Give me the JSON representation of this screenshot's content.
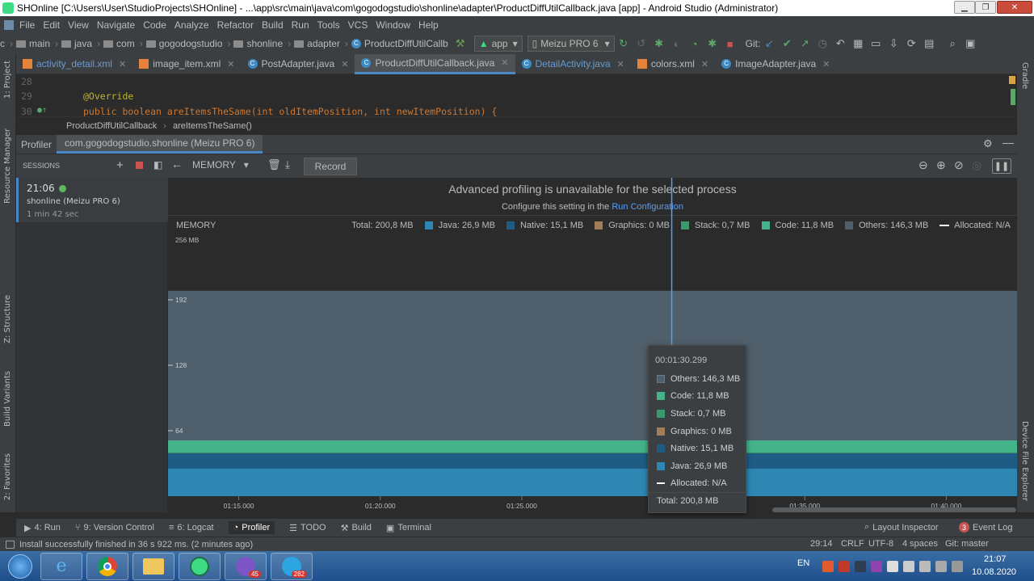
{
  "window": {
    "title": "SHOnline [C:\\Users\\User\\StudioProjects\\SHOnline] - ...\\app\\src\\main\\java\\com\\gogodogstudio\\shonline\\adapter\\ProductDiffUtilCallback.java [app] - Android Studio (Administrator)",
    "minimize": "▁",
    "maximize": "❐",
    "close": "✕"
  },
  "menu": [
    "File",
    "Edit",
    "View",
    "Navigate",
    "Code",
    "Analyze",
    "Refactor",
    "Build",
    "Run",
    "Tools",
    "VCS",
    "Window",
    "Help"
  ],
  "nav": {
    "crumbs": [
      "c",
      "main",
      "java",
      "com",
      "gogodogstudio",
      "shonline",
      "adapter",
      "ProductDiffUtilCallb"
    ],
    "run_config": "app",
    "device": "Meizu PRO 6",
    "git_label": "Git:"
  },
  "left_tools": [
    "1: Project",
    "Resource Manager",
    "Z: Structure",
    "Build Variants",
    "2: Favorites"
  ],
  "right_tools": [
    "Gradle",
    "Device File Explorer"
  ],
  "tabs": [
    {
      "label": "activity_detail.xml",
      "type": "xml",
      "active": false
    },
    {
      "label": "image_item.xml",
      "type": "xml",
      "active": false
    },
    {
      "label": "PostAdapter.java",
      "type": "java",
      "active": false
    },
    {
      "label": "ProductDiffUtilCallback.java",
      "type": "java",
      "active": true
    },
    {
      "label": "DetailActivity.java",
      "type": "java",
      "active": false
    },
    {
      "label": "colors.xml",
      "type": "xml",
      "active": false
    },
    {
      "label": "ImageAdapter.java",
      "type": "java",
      "active": false
    }
  ],
  "editor": {
    "lines": [
      {
        "num": "28",
        "text": ""
      },
      {
        "num": "29",
        "text": "@Override"
      },
      {
        "num": "30",
        "text": "public boolean areItemsTheSame(int oldItemPosition, int newItemPosition) {"
      }
    ],
    "breadcrumb": [
      "ProductDiffUtilCallback",
      "areItemsTheSame()"
    ]
  },
  "profiler": {
    "tab_label": "Profiler",
    "process_tab": "com.gogodogstudio.shonline (Meizu PRO 6)",
    "sessions_label": "SESSIONS",
    "view_dropdown": "MEMORY",
    "record_button": "Record",
    "session": {
      "time": "21:06",
      "name": "shonline (Meizu PRO 6)",
      "duration": "1 min 42 sec"
    },
    "banner_title": "Advanced profiling is unavailable for the selected process",
    "banner_sub_prefix": "Configure this setting in the",
    "banner_sub_link": "Run Configuration",
    "memory_label": "MEMORY",
    "legend": [
      {
        "label": "Total: 200,8 MB",
        "color": ""
      },
      {
        "label": "Java: 26,9 MB",
        "color": "#2e86b3"
      },
      {
        "label": "Native: 15,1 MB",
        "color": "#1f5c84"
      },
      {
        "label": "Graphics: 0 MB",
        "color": "#a07e5a"
      },
      {
        "label": "Stack: 0,7 MB",
        "color": "#3a9a6b"
      },
      {
        "label": "Code: 11,8 MB",
        "color": "#45b38a"
      },
      {
        "label": "Others: 146,3 MB",
        "color": "#4f5f6b"
      },
      {
        "label": "Allocated: N/A",
        "color": "dash"
      }
    ],
    "tooltip": {
      "time": "00:01:30.299",
      "rows": [
        {
          "label": "Others: 146,3 MB",
          "color": "#4f5f6b"
        },
        {
          "label": "Code: 11,8 MB",
          "color": "#45b38a"
        },
        {
          "label": "Stack: 0,7 MB",
          "color": "#3a9a6b"
        },
        {
          "label": "Graphics: 0 MB",
          "color": "#a07e5a"
        },
        {
          "label": "Native: 15,1 MB",
          "color": "#1f5c84"
        },
        {
          "label": "Java: 26,9 MB",
          "color": "#2e86b3"
        },
        {
          "label": "Allocated: N/A",
          "color": "dash"
        }
      ],
      "total": "Total: 200,8 MB"
    }
  },
  "chart_data": {
    "type": "area",
    "title": "MEMORY",
    "y_unit_label": "256 MB",
    "y_ticks": [
      "192",
      "128",
      "64"
    ],
    "ylim": [
      0,
      256
    ],
    "x_ticks": [
      "01:15.000",
      "01:20.000",
      "01:25.000",
      "01:30.000",
      "01:35.000",
      "01:40.000"
    ],
    "xlim_seconds": [
      72.5,
      102.5
    ],
    "x_data_seconds": [
      72.5,
      102.5
    ],
    "series": [
      {
        "name": "Java",
        "values": [
          26.9,
          26.9
        ],
        "color": "#2e86b3"
      },
      {
        "name": "Native",
        "values": [
          15.1,
          15.1
        ],
        "color": "#1f5c84"
      },
      {
        "name": "Graphics",
        "values": [
          0,
          0
        ],
        "color": "#a07e5a"
      },
      {
        "name": "Stack",
        "values": [
          0.7,
          0.7
        ],
        "color": "#3a9a6b"
      },
      {
        "name": "Code",
        "values": [
          11.8,
          11.8
        ],
        "color": "#45b38a"
      },
      {
        "name": "Others",
        "values": [
          146.3,
          146.3
        ],
        "color": "#4f5f6b"
      }
    ],
    "total": 200.8,
    "cursor_seconds": 90.299
  },
  "bottom_tools": [
    {
      "label": "4: Run",
      "icon": "▶"
    },
    {
      "label": "9: Version Control",
      "icon": "⑂"
    },
    {
      "label": "6: Logcat",
      "icon": "≡"
    },
    {
      "label": "Profiler",
      "icon": "◔",
      "active": true
    },
    {
      "label": "TODO",
      "icon": "☰"
    },
    {
      "label": "Build",
      "icon": "⚒"
    },
    {
      "label": "Terminal",
      "icon": "▣"
    }
  ],
  "right_bottom_tools": [
    {
      "label": "Layout Inspector",
      "icon": "⌕"
    },
    {
      "label": "Event Log",
      "badge": "3"
    }
  ],
  "status": {
    "message": "Install successfully finished in 36 s 922 ms. (2 minutes ago)",
    "position": "29:14",
    "line_sep": "CRLF",
    "encoding": "UTF-8",
    "indent": "4 spaces",
    "branch": "Git: master"
  },
  "taskbar": {
    "lang": "EN",
    "time": "21:07",
    "date": "10.08.2020",
    "viber_badge": "45",
    "telegram_badge": "282"
  }
}
